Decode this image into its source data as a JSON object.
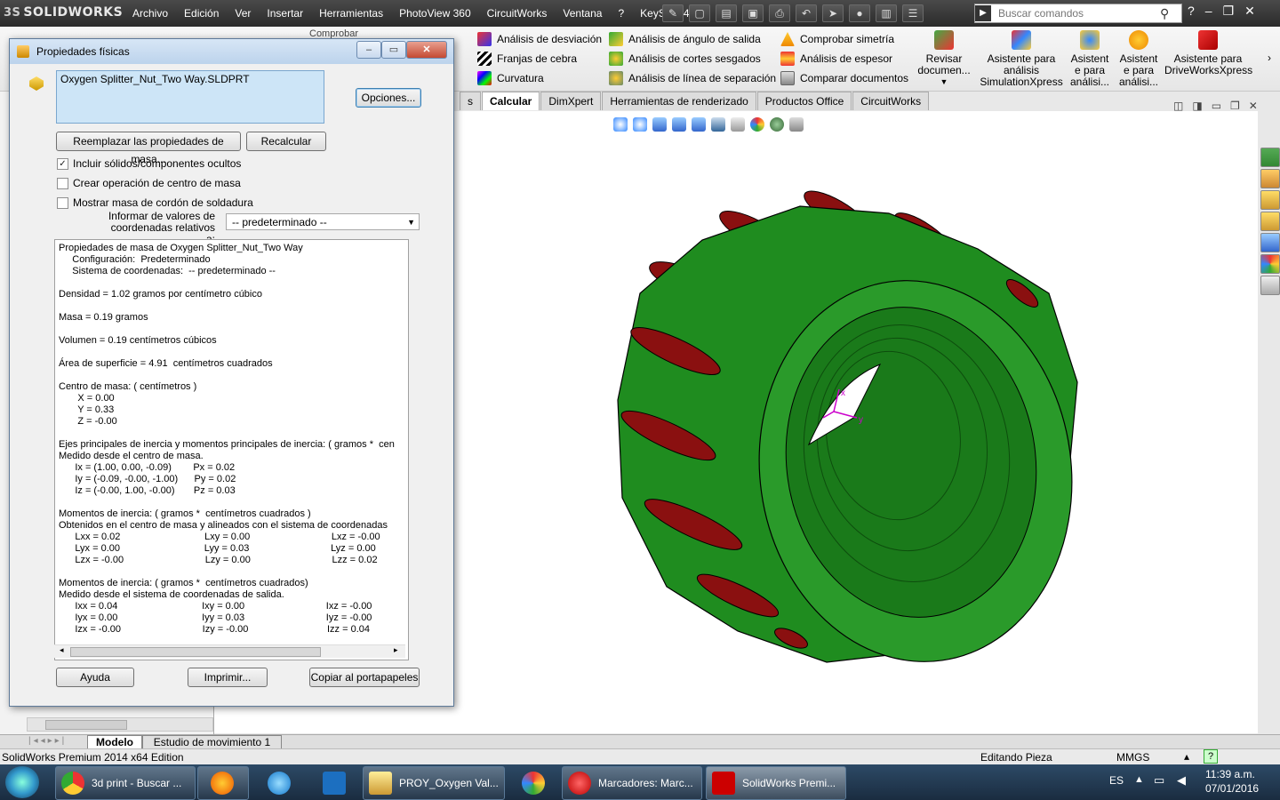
{
  "app": {
    "logo": "SOLIDWORKS",
    "logo_prefix": "3S",
    "menus": [
      "Archivo",
      "Edición",
      "Ver",
      "Insertar",
      "Herramientas",
      "PhotoView 360",
      "CircuitWorks",
      "Ventana",
      "?",
      "KeyShot 4"
    ],
    "search_placeholder": "Buscar comandos"
  },
  "ribbon": {
    "col1": [
      "Análisis de desviación",
      "Franjas de cebra",
      "Curvatura"
    ],
    "col2": [
      "Análisis de ángulo de salida",
      "Análisis de cortes sesgados",
      "Análisis de línea de separación"
    ],
    "col3": [
      "Comprobar simetría",
      "Análisis de espesor",
      "Comparar documentos"
    ],
    "big": [
      {
        "label": "Revisar documen..."
      },
      {
        "label": "Asistente para análisis SimulationXpress"
      },
      {
        "label": "Asistent e para análisi..."
      },
      {
        "label": "Asistent e para análisi..."
      },
      {
        "label": "Asistente para DriveWorksXpress"
      }
    ],
    "partial_label": "Comprobar"
  },
  "tabs": [
    "s",
    "Calcular",
    "DimXpert",
    "Herramientas de renderizado",
    "Productos Office",
    "CircuitWorks"
  ],
  "dialog": {
    "title": "Propiedades físicas",
    "filename": "Oxygen Splitter_Nut_Two Way.SLDPRT",
    "options_btn": "Opciones...",
    "replace_btn": "Reemplazar las propiedades de masa...",
    "recalc_btn": "Recalcular",
    "chk_hidden": "Incluir sólidos/componentes ocultos",
    "chk_center": "Crear operación de centro de masa",
    "chk_weld": "Mostrar masa de cordón de soldadura",
    "coord_label_1": "Informar de valores de",
    "coord_label_2": "coordenadas relativos a:",
    "coord_value": "-- predeterminado --",
    "help_btn": "Ayuda",
    "print_btn": "Imprimir...",
    "copy_btn": "Copiar al portapapeles",
    "results": [
      "Propiedades de masa de Oxygen Splitter_Nut_Two Way",
      "     Configuración:  Predeterminado",
      "     Sistema de coordenadas:  -- predeterminado --",
      "",
      "Densidad = 1.02 gramos por centímetro cúbico",
      "",
      "Masa = 0.19 gramos",
      "",
      "Volumen = 0.19 centímetros cúbicos",
      "",
      "Área de superficie = 4.91  centímetros cuadrados",
      "",
      "Centro de masa: ( centímetros )",
      "       X = 0.00",
      "       Y = 0.33",
      "       Z = -0.00",
      "",
      "Ejes principales de inercia y momentos principales de inercia: ( gramos *  cen",
      "Medido desde el centro de masa.",
      "      Ix = (1.00, 0.00, -0.09)        Px = 0.02",
      "      Iy = (-0.09, -0.00, -1.00)      Py = 0.02",
      "      Iz = (-0.00, 1.00, -0.00)       Pz = 0.03",
      "",
      "Momentos de inercia: ( gramos *  centímetros cuadrados )",
      "Obtenidos en el centro de masa y alineados con el sistema de coordenadas",
      "      Lxx = 0.02                               Lxy = 0.00                              Lxz = -0.00",
      "      Lyx = 0.00                               Lyy = 0.03                              Lyz = 0.00",
      "      Lzx = -0.00                              Lzy = 0.00                              Lzz = 0.02",
      "",
      "Momentos de inercia: ( gramos *  centímetros cuadrados)",
      "Medido desde el sistema de coordenadas de salida.",
      "      Ixx = 0.04                               Ixy = 0.00                              Ixz = -0.00",
      "      Iyx = 0.00                               Iyy = 0.03                              Iyz = -0.00",
      "      Izx = -0.00                              Izy = -0.00                             Izz = 0.04"
    ]
  },
  "model_tabs": [
    "Modelo",
    "Estudio de movimiento 1"
  ],
  "status": {
    "edition": "SolidWorks Premium 2014 x64 Edition",
    "mode": "Editando Pieza",
    "units": "MMGS"
  },
  "taskbar": {
    "items": [
      {
        "label": "3d print - Buscar ..."
      },
      {
        "label": ""
      },
      {
        "label": ""
      },
      {
        "label": ""
      },
      {
        "label": "PROY_Oxygen Val..."
      },
      {
        "label": ""
      },
      {
        "label": "Marcadores: Marc..."
      },
      {
        "label": "SolidWorks Premi..."
      }
    ],
    "lang": "ES",
    "time": "11:39 a.m.",
    "date": "07/01/2016"
  },
  "axes": {
    "x": "x",
    "y": "y"
  },
  "colors": {
    "green": "#1f8c1f",
    "red": "#8a1010",
    "dialog_title": "#bcd3ec"
  }
}
